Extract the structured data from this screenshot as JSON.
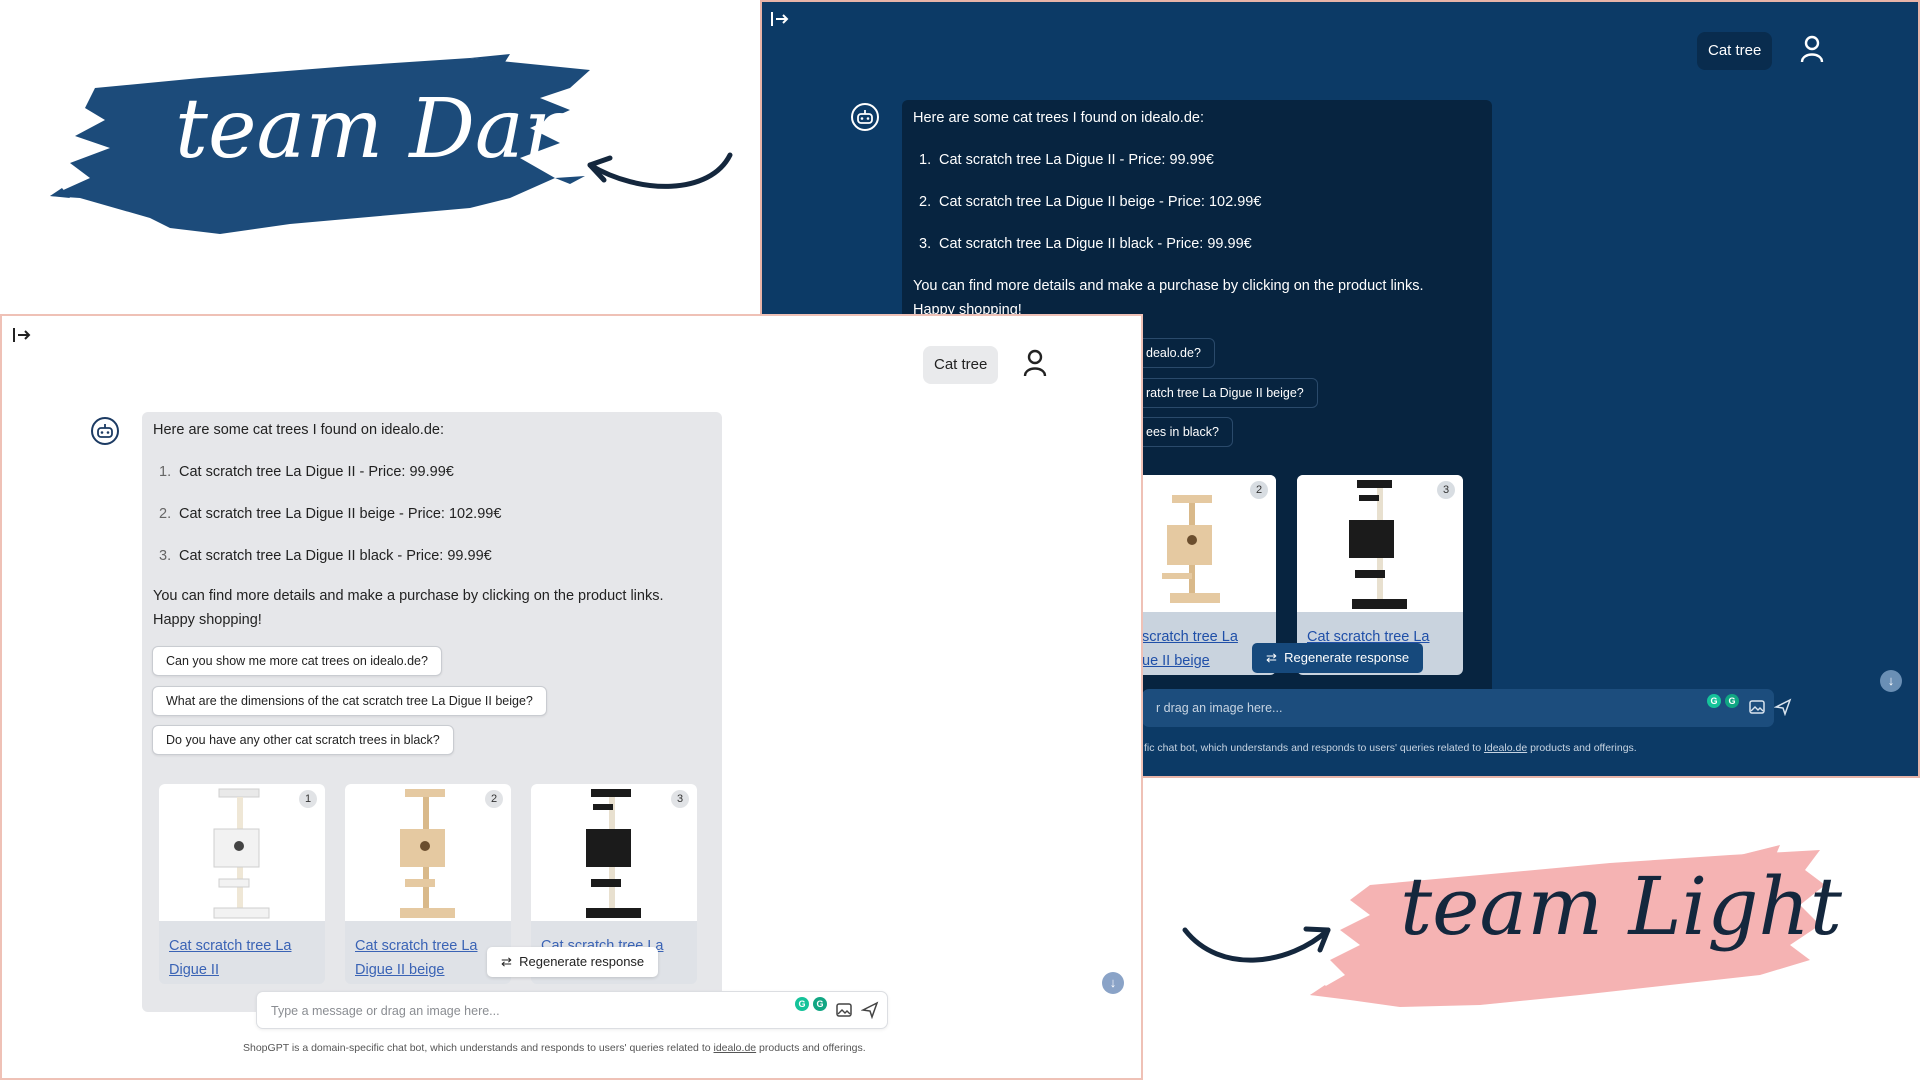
{
  "labels": {
    "dark_label": "team Dark",
    "light_label": "team Light",
    "dark_brush_color": "#1c4b7a",
    "light_brush_color": "#f5b3b3",
    "arrow_color": "#14273d"
  },
  "chat": {
    "chip_label": "Cat tree",
    "intro": "Here are some cat trees I found on idealo.de:",
    "items": [
      {
        "num": "1.",
        "text": "Cat scratch tree La Digue II - Price: 99.99€"
      },
      {
        "num": "2.",
        "text": "Cat scratch tree La Digue II beige - Price: 102.99€"
      },
      {
        "num": "3.",
        "text": "Cat scratch tree La Digue II black - Price: 99.99€"
      }
    ],
    "outro_line1": "You can find more details and make a purchase by clicking on the product links.",
    "outro_line2": "Happy shopping!",
    "suggestions": [
      "Can you show me more cat trees on idealo.de?",
      "What are the dimensions of the cat scratch tree La Digue II beige?",
      "Do you have any other cat scratch trees in black?"
    ],
    "cards": [
      {
        "badge": "1",
        "line1": "Cat scratch tree La",
        "line2": "Digue II",
        "color": "#f2f2f2"
      },
      {
        "badge": "2",
        "line1": "Cat scratch tree La",
        "line2": "Digue II beige",
        "color": "#e5c9a1"
      },
      {
        "badge": "3",
        "line1": "Cat scratch tree La",
        "line2": "",
        "color": "#1b1b1b"
      }
    ],
    "regenerate_label": "Regenerate response",
    "input_placeholder": "Type a message or drag an image here...",
    "dark_suggestion_fragments": [
      "dealo.de?",
      "ratch tree La Digue II beige?",
      "ees in black?"
    ],
    "dark_card_fragments": [
      {
        "badge": "2",
        "line1": " scratch tree La",
        "line2": "ue II beige",
        "color": "#e5c9a1"
      },
      {
        "badge": "3",
        "line1": "Cat scratch tree La",
        "line2": "",
        "color": "#1b1b1b"
      }
    ],
    "dark_input_fragment": "r drag an image here...",
    "footer_prefix": "ShopGPT is a domain-specific chat bot, which understands and responds to users' queries related to ",
    "footer_link": "Idealo.de",
    "footer_link_light": "idealo.de",
    "footer_suffix": " products and offerings.",
    "dark_footer_prefix": "fic chat bot, which understands and responds to users' queries related to "
  },
  "icons": {
    "sidebar_toggle": "sidebar-toggle-icon",
    "user": "user-icon",
    "bot": "bot-icon",
    "regenerate": "refresh-icon",
    "image": "image-icon",
    "send": "send-icon",
    "scroll": "arrow-down-icon",
    "grammarly": "grammarly-icon"
  }
}
